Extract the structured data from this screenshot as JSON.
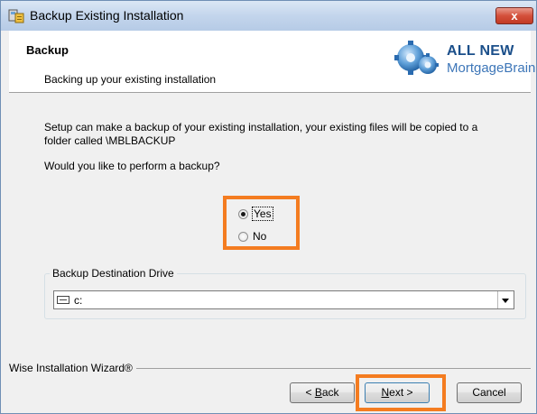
{
  "window": {
    "title": "Backup Existing Installation",
    "close_symbol": "x",
    "icon": "installer-icon"
  },
  "header": {
    "title": "Backup",
    "subtitle": "Backing up your existing installation",
    "logo": {
      "line1": "ALL NEW",
      "line2": "MortgageBrain"
    }
  },
  "content": {
    "intro_line1": "Setup can make a backup of your existing installation, your existing files will be copied to a",
    "intro_line2": "folder called \\MBLBACKUP",
    "question": "Would you like to perform a backup?",
    "options": [
      {
        "label": "Yes",
        "selected": true
      },
      {
        "label": "No",
        "selected": false
      }
    ],
    "destination": {
      "group_label": "Backup Destination Drive",
      "selected_drive": "c:",
      "drive_icon": "drive-icon"
    }
  },
  "footer": {
    "wizard_label": "Wise Installation Wizard®",
    "back_prefix": "< ",
    "back_mnemonic": "B",
    "back_rest": "ack",
    "next_mnemonic": "N",
    "next_rest": "ext >",
    "cancel_label": "Cancel"
  },
  "colors": {
    "highlight": "#f47c20",
    "logo_dark": "#1b4f8a",
    "logo_light": "#3d76b8"
  }
}
